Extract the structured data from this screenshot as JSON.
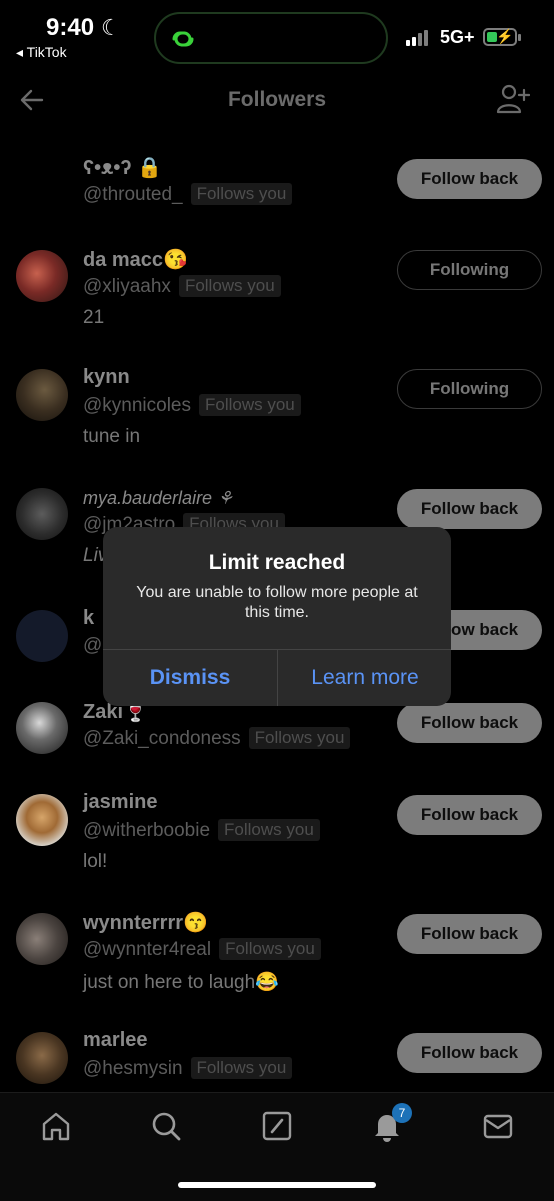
{
  "status_bar": {
    "time": "9:40",
    "back_app": "◂ TikTok",
    "network": "5G+"
  },
  "header": {
    "title": "Followers"
  },
  "followers": [
    {
      "name": "ʕ•ᴥ•ʔ 🔒",
      "handle": "@throuted_",
      "badge": "Follows you",
      "bio": "",
      "button": "Follow back"
    },
    {
      "name": "da macc😘",
      "handle": "@xliyaahx",
      "badge": "Follows you",
      "bio": "21",
      "button": "Following"
    },
    {
      "name": "kynn",
      "handle": "@kynnicoles",
      "badge": "Follows you",
      "bio": "tune in",
      "button": "Following"
    },
    {
      "name": "mya.bauderlaire ⚘",
      "handle": "@jm2astro",
      "badge": "Follows you",
      "bio": "Liv",
      "button": "Follow back"
    },
    {
      "name": "k",
      "handle": "@",
      "badge": "",
      "bio": "",
      "button": "Follow back"
    },
    {
      "name": "Zaki🍷",
      "handle": "@Zaki_condoness",
      "badge": "Follows you",
      "bio": "",
      "button": "Follow back"
    },
    {
      "name": "jasmine",
      "handle": "@witherboobie",
      "badge": "Follows you",
      "bio": "lol!",
      "button": "Follow back"
    },
    {
      "name": "wynnterrrr😙",
      "handle": "@wynnter4real",
      "badge": "Follows you",
      "bio": "just on here to laugh😂",
      "button": "Follow back"
    },
    {
      "name": "marlee",
      "handle": "@hesmysin",
      "badge": "Follows you",
      "bio": "",
      "button": "Follow back"
    }
  ],
  "alert": {
    "title": "Limit reached",
    "message": "You are unable to follow more people at this time.",
    "dismiss": "Dismiss",
    "learn_more": "Learn more"
  },
  "tab_bar": {
    "items": [
      "home-icon",
      "search-icon",
      "compose-icon",
      "bell-icon",
      "mail-icon"
    ],
    "notification_count": "7"
  },
  "colors": {
    "background": "#000000",
    "alert_bg": "#2a2a2a",
    "alert_button": "#5a93f5",
    "follow_button": "#7c7c7c",
    "badge_blue": "#1d72b8"
  }
}
